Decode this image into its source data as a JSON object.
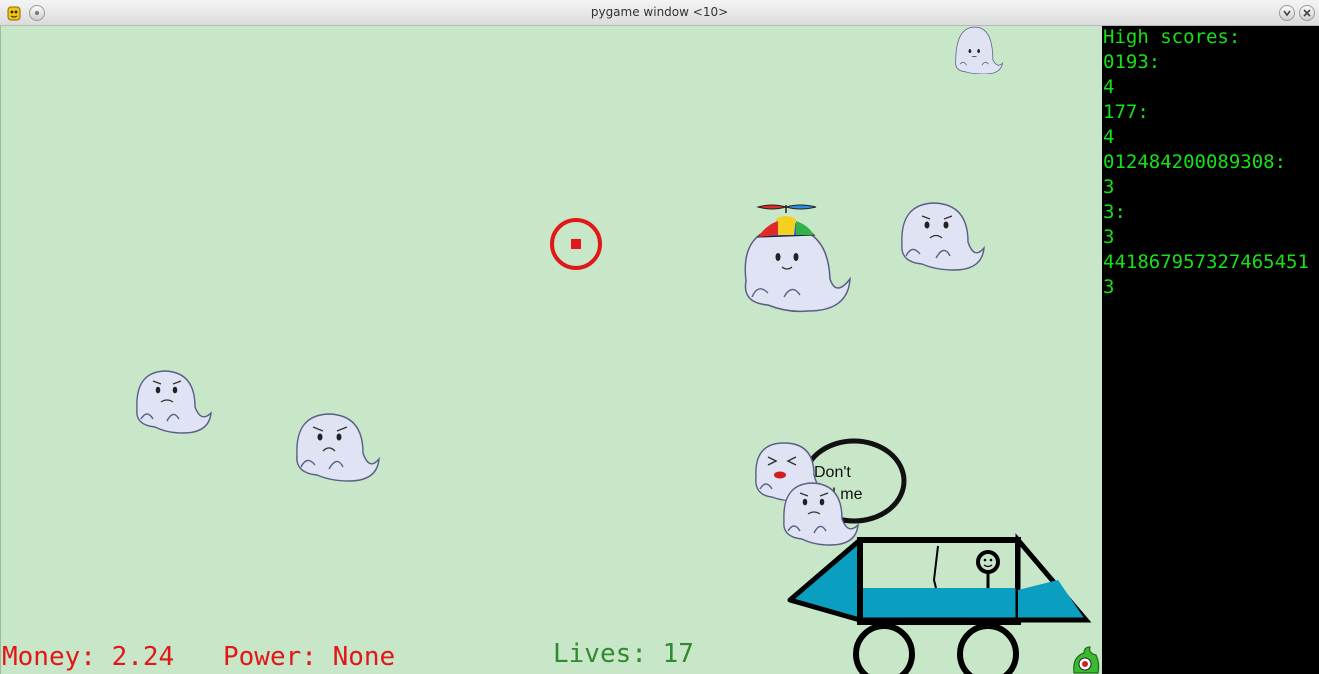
{
  "window": {
    "title": "pygame window <10>"
  },
  "side_panel": {
    "lines": [
      "High scores:",
      "0193:",
      "4",
      "177:",
      "4",
      "012484200089308:",
      "3",
      "3:",
      "3",
      "441867957327465451",
      "3"
    ]
  },
  "hud": {
    "money": "Money: 2.24",
    "power": "Power: None",
    "lives": "Lives: 17"
  },
  "speech_bubble": {
    "line1": "Don't",
    "line2": "find me"
  },
  "colors": {
    "background": "#c8e6c8",
    "hud_red": "#e01818",
    "hud_green": "#2e8b2e",
    "score_text": "#16e016",
    "crosshair": "#e01818",
    "car_fill": "#0a9fc0"
  },
  "icons": {
    "app": "pygame-icon",
    "minimize": "chevron-down-icon",
    "close": "close-icon",
    "crosshair": "crosshair-icon",
    "corner": "green-monster-icon"
  }
}
